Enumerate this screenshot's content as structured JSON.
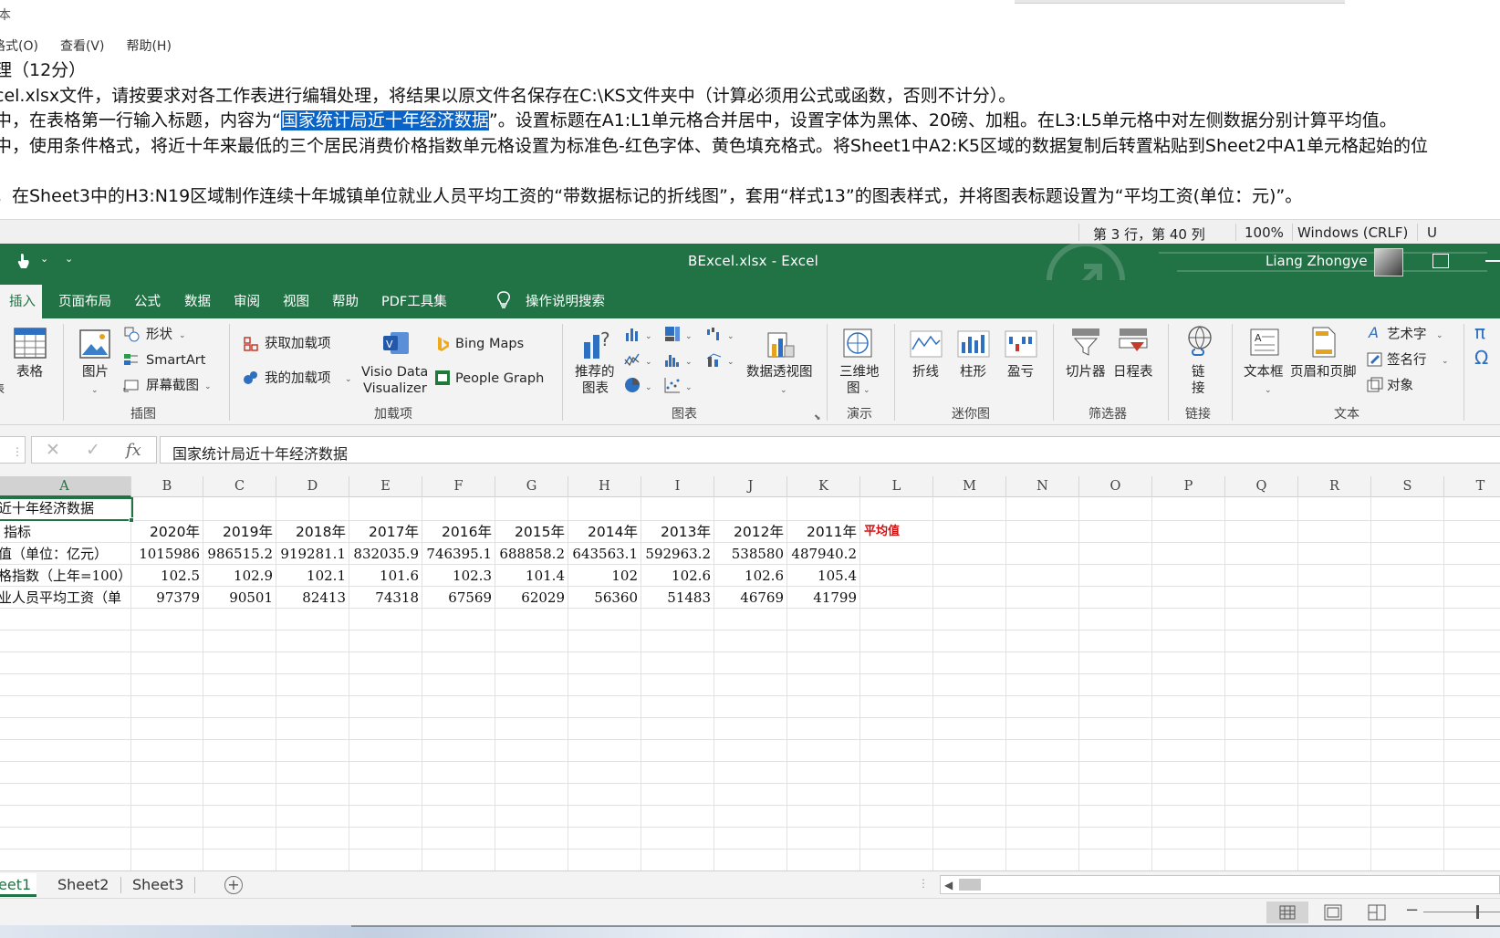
{
  "notepad": {
    "title": "本",
    "menu": [
      "格式(O)",
      "查看(V)",
      "帮助(H)"
    ],
    "lines": [
      {
        "pre": "理（12分）",
        "sel": "",
        "post": ""
      },
      {
        "pre": "cel.xlsx文件，请按要求对各工作表进行编辑处理，将结果以原文件名保存在C:\\KS文件夹中（计算必须用公式或函数，否则不计分）。",
        "sel": "",
        "post": ""
      },
      {
        "pre": "中，在表格第一行输入标题，内容为“",
        "sel": "国家统计局近十年经济数据",
        "post": "”。设置标题在A1:L1单元格合并居中，设置字体为黑体、20磅、加粗。在L3:L5单元格中对左侧数据分别计算平均值。"
      },
      {
        "pre": "中，使用条件格式，将近十年来最低的三个居民消费价格指数单元格设置为标准色-红色字体、黄色填充格式。将Sheet1中A2:K5区域的数据复制后转置粘贴到Sheet2中A1单元格起始的位",
        "sel": "",
        "post": ""
      },
      {
        "pre": "",
        "sel": "",
        "post": ""
      },
      {
        "pre": "，在Sheet3中的H3:N19区域制作连续十年城镇单位就业人员平均工资的“带数据标记的折线图”，套用“样式13”的图表样式，并将图表标题设置为“平均工资(单位：元)”。",
        "sel": "",
        "post": ""
      }
    ],
    "status": {
      "position": "第 3 行，第 40 列",
      "zoom": "100%",
      "eol": "Windows (CRLF)",
      "encoding": "U"
    }
  },
  "excel": {
    "filename": "BExcel.xlsx  -  Excel",
    "user": "Liang Zhongye",
    "tabs": [
      "插入",
      "页面布局",
      "公式",
      "数据",
      "审阅",
      "视图",
      "帮助",
      "PDF工具集",
      "操作说明搜索"
    ],
    "ribbon": {
      "tables": {
        "label": "表格",
        "edge": "表"
      },
      "illustrations": {
        "group": "插图",
        "pictures": "图片",
        "shapes": "形状",
        "smartart": "SmartArt",
        "screenshot": "屏幕截图"
      },
      "addins": {
        "group": "加载项",
        "get": "获取加载项",
        "my": "我的加载项",
        "visio1": "Visio Data",
        "visio2": "Visualizer",
        "bing": "Bing Maps",
        "people": "People Graph"
      },
      "charts": {
        "group": "图表",
        "recommended1": "推荐的",
        "recommended2": "图表",
        "pivot": "数据透视图"
      },
      "tours": {
        "group": "演示",
        "map3d1": "三维地",
        "map3d2": "图"
      },
      "sparklines": {
        "group": "迷你图",
        "line": "折线",
        "column": "柱形",
        "winloss": "盈亏"
      },
      "filters": {
        "group": "筛选器",
        "slicer": "切片器",
        "timeline": "日程表"
      },
      "links": {
        "group": "链接",
        "link1": "链",
        "link2": "接"
      },
      "text": {
        "group": "文本",
        "textbox": "文本框",
        "headerfooter": "页眉和页脚",
        "wordart": "艺术字",
        "signature": "签名行",
        "object": "对象"
      },
      "symbols": {
        "equation": "π",
        "symbol": "Ω"
      }
    },
    "formula": {
      "content": "国家统计局近十年经济数据"
    },
    "columns": [
      "A",
      "B",
      "C",
      "D",
      "E",
      "F",
      "G",
      "H",
      "I",
      "J",
      "K",
      "L",
      "M",
      "N",
      "O",
      "P",
      "Q",
      "R",
      "S",
      "T"
    ],
    "a1": "近十年经济数据",
    "header_row": {
      "label": "指标",
      "years": [
        "2020年",
        "2019年",
        "2018年",
        "2017年",
        "2016年",
        "2015年",
        "2014年",
        "2013年",
        "2012年",
        "2011年"
      ],
      "avg": "平均值"
    },
    "rows": [
      {
        "label": "值（单位：亿元）",
        "values": [
          "1015986",
          "986515.2",
          "919281.1",
          "832035.9",
          "746395.1",
          "688858.2",
          "643563.1",
          "592963.2",
          "538580",
          "487940.2"
        ]
      },
      {
        "label": "格指数（上年=100）",
        "values": [
          "102.5",
          "102.9",
          "102.1",
          "101.6",
          "102.3",
          "101.4",
          "102",
          "102.6",
          "102.6",
          "105.4"
        ]
      },
      {
        "label": "业人员平均工资（单",
        "values": [
          "97379",
          "90501",
          "82413",
          "74318",
          "67569",
          "62029",
          "56360",
          "51483",
          "46769",
          "41799"
        ]
      }
    ],
    "sheets": [
      "eet1",
      "Sheet2",
      "Sheet3"
    ],
    "colors": {
      "green": "#217346",
      "selection": "#0a64c8",
      "avg_red": "#d01010"
    }
  }
}
